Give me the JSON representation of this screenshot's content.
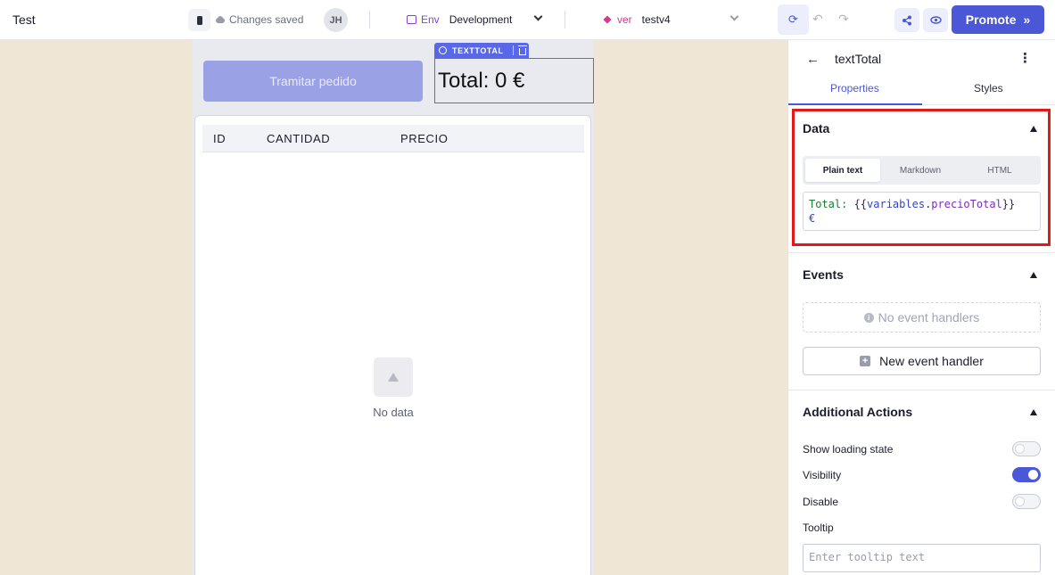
{
  "header": {
    "app_name": "Test",
    "save_status": "Changes saved",
    "user_initials": "JH",
    "env_label": "Env",
    "env_value": "Development",
    "version_label": "ver",
    "version_value": "testv4",
    "promote_label": "Promote",
    "icons": [
      "device-phone-icon",
      "cloud-icon",
      "environment-icon",
      "version-layers-icon",
      "sync-icon",
      "undo-icon",
      "redo-icon",
      "share-icon",
      "preview-eye-icon"
    ]
  },
  "canvas": {
    "button_label": "Tramitar pedido",
    "selected_component_label": "TEXTTOTAL",
    "total_text": "Total: 0 €",
    "table": {
      "columns": [
        "ID",
        "CANTIDAD",
        "PRECIO"
      ],
      "empty_text": "No data"
    }
  },
  "panel": {
    "component_name": "textTotal",
    "tabs": [
      "Properties",
      "Styles"
    ],
    "active_tab": "Properties",
    "data_section": {
      "title": "Data",
      "format_options": [
        "Plain text",
        "Markdown",
        "HTML"
      ],
      "selected_format": "Plain text",
      "code_parts": {
        "prefix": "Total: ",
        "open": "{{",
        "obj": "variables",
        "dot": ".",
        "prop": "precioTotal",
        "close": "}}",
        "suffix": "€"
      }
    },
    "events_section": {
      "title": "Events",
      "empty_text": "No event handlers",
      "new_handler_label": "New event handler"
    },
    "actions_section": {
      "title": "Additional Actions",
      "show_loading_label": "Show loading state",
      "show_loading_on": false,
      "visibility_label": "Visibility",
      "visibility_on": true,
      "disable_label": "Disable",
      "disable_on": false,
      "tooltip_label": "Tooltip",
      "tooltip_placeholder": "Enter tooltip text"
    }
  },
  "colors": {
    "accent": "#4a57d6",
    "highlight_box": "#e11919",
    "canvas_bg": "#efe6d6"
  }
}
